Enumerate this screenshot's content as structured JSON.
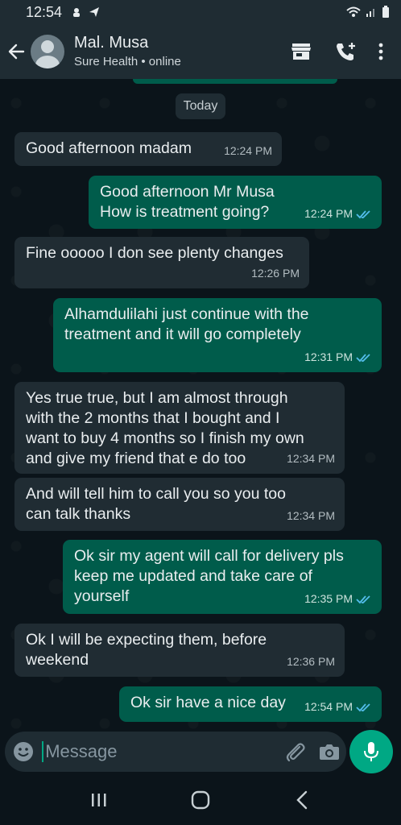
{
  "status": {
    "time": "12:54"
  },
  "header": {
    "contact_name": "Mal. Musa",
    "subtitle": "Sure Health • online"
  },
  "chat": {
    "date_label": "Today",
    "messages": [
      {
        "direction": "in",
        "text": "Good afternoon madam",
        "time": "12:24 PM"
      },
      {
        "direction": "out",
        "text": "Good afternoon Mr Musa\nHow is treatment going?",
        "time": "12:24 PM",
        "read": true
      },
      {
        "direction": "in",
        "text": "Fine ooooo I don see plenty changes",
        "time": "12:26 PM"
      },
      {
        "direction": "out",
        "text": "Alhamdulilahi just continue with the\ntreatment and it will go completely",
        "time": "12:31 PM",
        "read": true
      },
      {
        "direction": "in",
        "text": "Yes true true, but I am almost through\nwith the 2 months that I bought and I\nwant to buy 4 months so I finish my own\nand give my friend that e do too",
        "time": "12:34 PM"
      },
      {
        "direction": "in",
        "text": "And will tell him to call you so you too\ncan talk thanks",
        "time": "12:34 PM"
      },
      {
        "direction": "out",
        "text": "Ok sir my agent will call for delivery pls\nkeep me updated and take care of\nyourself",
        "time": "12:35 PM",
        "read": true
      },
      {
        "direction": "in",
        "text": "Ok I will be expecting them, before\nweekend",
        "time": "12:36 PM"
      },
      {
        "direction": "out",
        "text": "Ok sir have a nice day",
        "time": "12:54 PM",
        "read": true
      }
    ]
  },
  "composer": {
    "placeholder": "Message"
  },
  "colors": {
    "incoming_bubble": "#202c33",
    "outgoing_bubble": "#005c4b",
    "accent": "#00a884",
    "read_tick": "#53bdeb"
  }
}
